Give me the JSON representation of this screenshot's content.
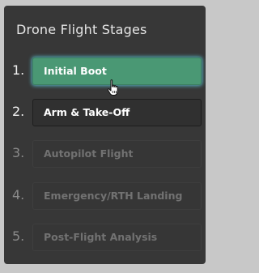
{
  "panel": {
    "title": "Drone Flight Stages"
  },
  "stages": [
    {
      "number": "1.",
      "label": "Initial Boot",
      "state": "active"
    },
    {
      "number": "2.",
      "label": "Arm & Take-Off",
      "state": "available"
    },
    {
      "number": "3.",
      "label": "Autopilot Flight",
      "state": "locked"
    },
    {
      "number": "4.",
      "label": "Emergency/RTH Landing",
      "state": "locked"
    },
    {
      "number": "5.",
      "label": "Post-Flight Analysis",
      "state": "locked"
    }
  ],
  "colors": {
    "active_fill": "#4a9874",
    "active_glow": "#5ac8d7",
    "panel_background": "#373737",
    "locked_text": "#727272"
  },
  "cursor": {
    "icon": "hand-pointer-icon"
  }
}
